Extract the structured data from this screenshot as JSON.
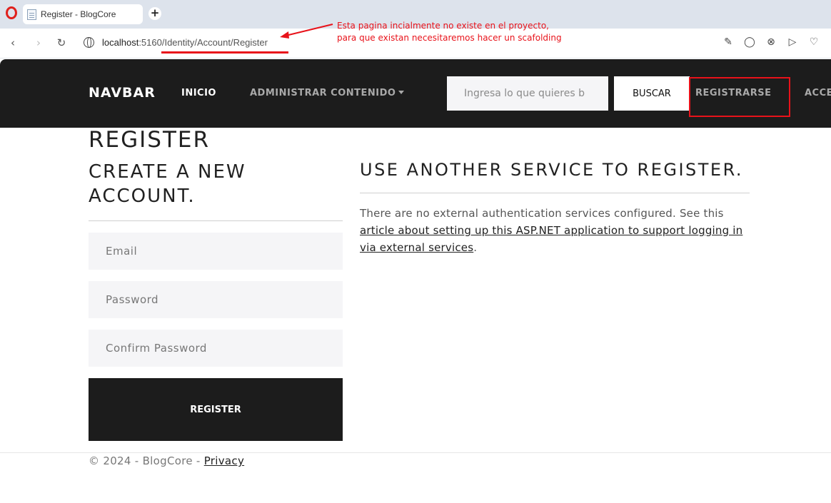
{
  "browser": {
    "tab_title": "Register - BlogCore",
    "new_tab_label": "+",
    "url_host": "localhost",
    "url_port_path": ":5160/Identity/Account/Register"
  },
  "annotation": {
    "line1": "Esta pagina incialmente no existe en el proyecto,",
    "line2": "para que existan necesitaremos hacer un scafolding",
    "color": "#e8121a"
  },
  "navbar": {
    "brand": "NAVBAR",
    "inicio": "INICIO",
    "admin": "ADMINISTRAR CONTENIDO",
    "search_placeholder": "Ingresa lo que quieres b",
    "search_button": "BUSCAR",
    "register": "REGISTRARSE",
    "access": "ACCE"
  },
  "main": {
    "page_title": "REGISTER",
    "left_heading": "CREATE A NEW ACCOUNT.",
    "email_placeholder": "Email",
    "password_placeholder": "Password",
    "confirm_placeholder": "Confirm Password",
    "register_button": "REGISTER",
    "right_heading": "USE ANOTHER SERVICE TO REGISTER.",
    "right_text": "There are no external authentication services configured. See this ",
    "right_link": "article about setting up this ASP.NET application to support logging in via external services",
    "right_end": "."
  },
  "footer": {
    "text": "© 2024 - BlogCore - ",
    "privacy": "Privacy"
  },
  "colors": {
    "navbar_bg": "#1c1c1c",
    "accent_red": "#e8121a"
  }
}
